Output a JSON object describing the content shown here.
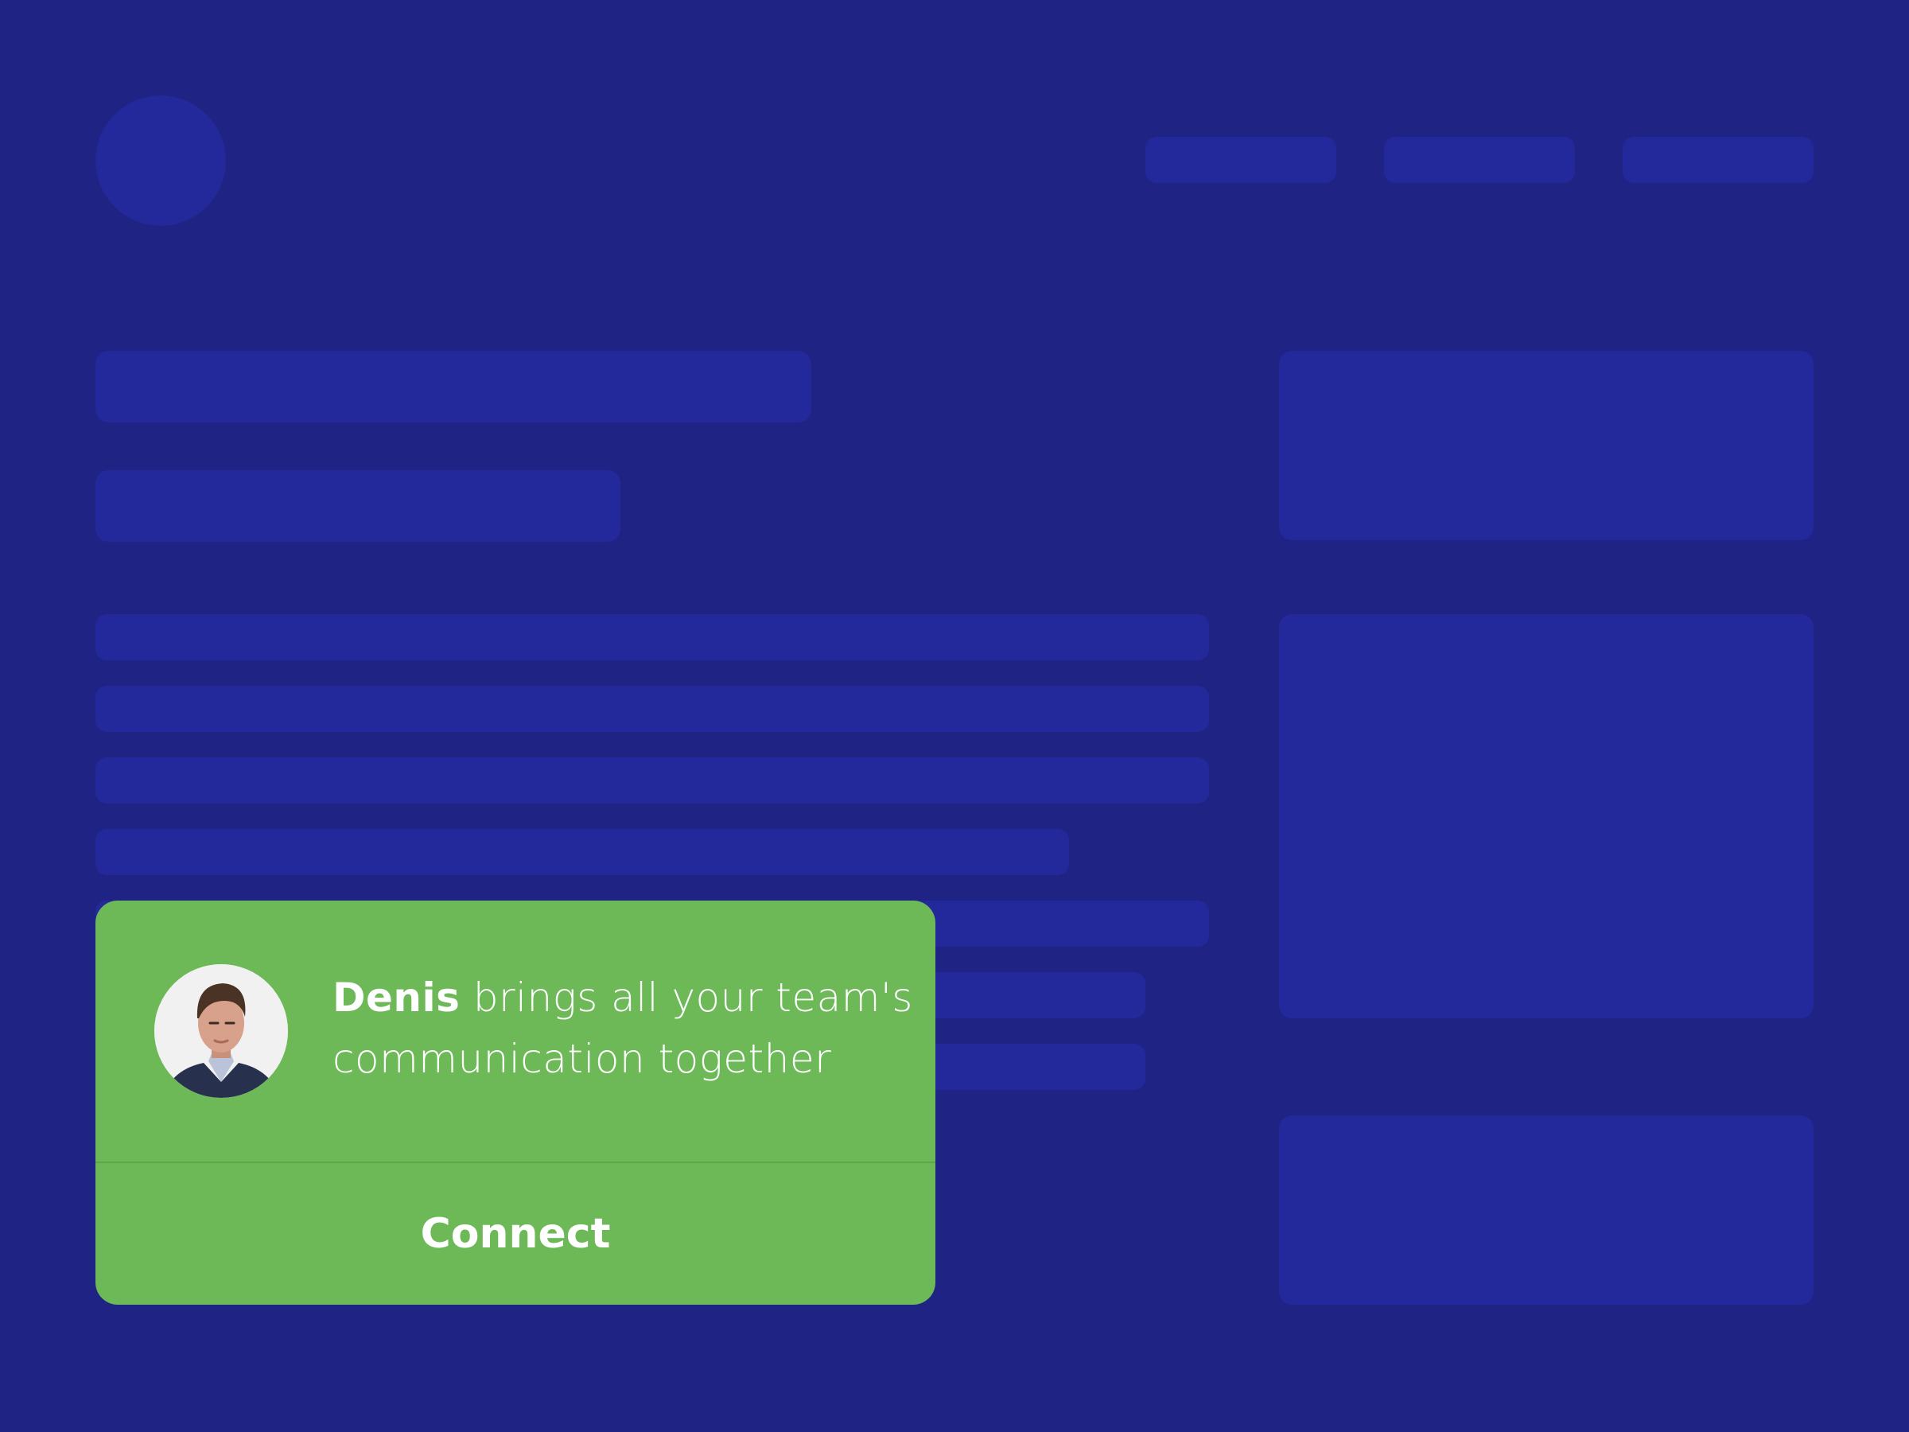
{
  "colors": {
    "background": "#1f2384",
    "placeholder": "#23289a",
    "card": "#6db958",
    "card_divider": "#5fa94b",
    "text": "#ffffff"
  },
  "card": {
    "sender_name": "Denis",
    "message": " brings all your team's communication together",
    "action_label": "Connect",
    "avatar_icon": "person-portrait-icon"
  }
}
